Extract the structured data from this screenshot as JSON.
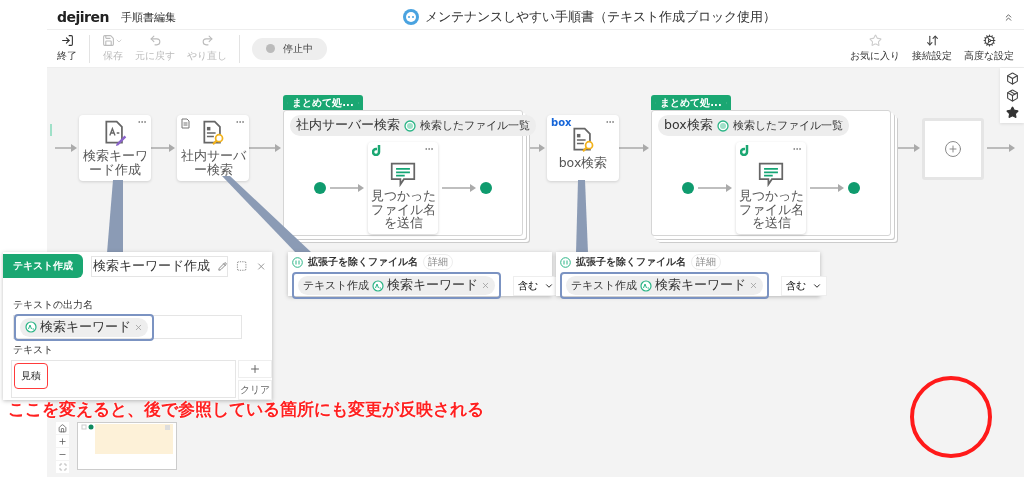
{
  "header": {
    "logo": "dejiren",
    "title": "手順書編集",
    "document_title": "メンテナンスしやすい手順書（テキスト作成ブロック使用）"
  },
  "toolbar": {
    "left": [
      {
        "kind": "exit",
        "label": "終了",
        "disabled": false
      },
      {
        "kind": "save",
        "label": "保存",
        "disabled": true
      },
      {
        "kind": "undo",
        "label": "元に戻す",
        "disabled": true
      },
      {
        "kind": "redo",
        "label": "やり直し",
        "disabled": true
      }
    ],
    "status": "停止中",
    "right": [
      {
        "kind": "favorite",
        "label": "お気に入り"
      },
      {
        "kind": "connection",
        "label": "接続設定"
      },
      {
        "kind": "advanced",
        "label": "高度な設定"
      }
    ]
  },
  "flow": [
    {
      "kind": "text_block",
      "label": "検索キーワード作成"
    },
    {
      "kind": "search_block",
      "label": "社内サーバー検索",
      "corner": {
        "kind": "doc"
      }
    },
    {
      "kind": "group",
      "tab": "まとめて処...",
      "source": "社内サーバー検索",
      "output": "検索したファイル一覧",
      "inner": {
        "kind": "message_block",
        "label": "見つかったファイル名を送信",
        "corner": {
          "kind": "mark"
        }
      }
    },
    {
      "kind": "search_block",
      "label": "box検索",
      "corner": {
        "kind": "logo",
        "text": "box"
      }
    },
    {
      "kind": "group",
      "tab": "まとめて処...",
      "source": "box検索",
      "output": "検索したファイル一覧",
      "inner": {
        "kind": "message_block",
        "label": "見つかったファイル名を送信",
        "corner": {
          "kind": "mark"
        }
      }
    },
    {
      "kind": "add"
    }
  ],
  "panels": [
    {
      "kind": "text_block",
      "tab": "テキスト作成",
      "name": "検索キーワード作成",
      "output_label": "テキストの出力名",
      "output_chip": "検索キーワード",
      "text_label": "テキスト",
      "text_value": "見積",
      "clear": "クリア"
    },
    {
      "kind": "condition",
      "title": "拡張子を除くファイル名",
      "detail": "詳細",
      "chip_source": "テキスト作成",
      "chip_value": "検索キーワード",
      "operator": "含む"
    },
    {
      "kind": "condition",
      "title": "拡張子を除くファイル名",
      "detail": "詳細",
      "chip_source": "テキスト作成",
      "chip_value": "検索キーワード",
      "operator": "含む"
    }
  ],
  "annotation": {
    "text": "ここを変えると、後で参照している箇所にも変更が反映される"
  }
}
